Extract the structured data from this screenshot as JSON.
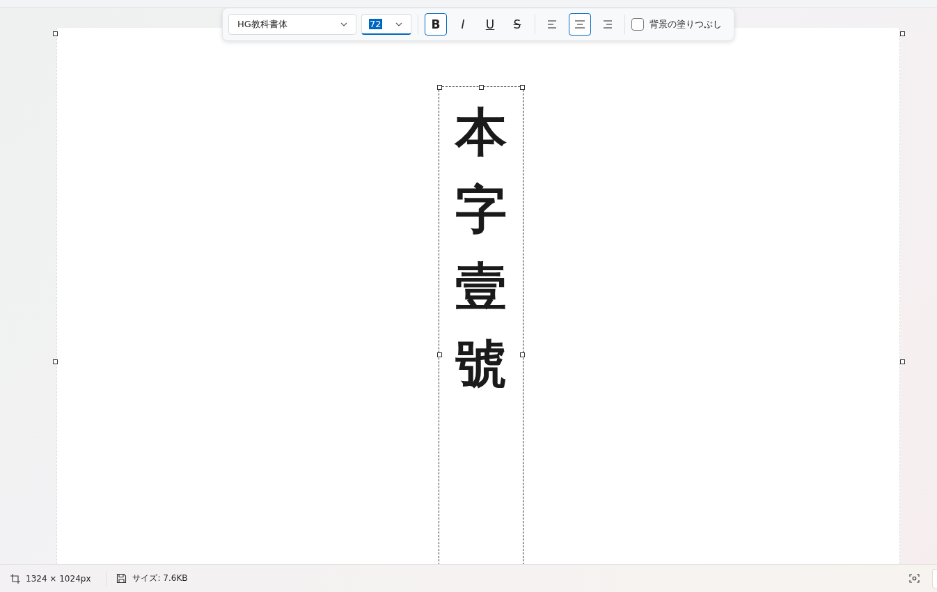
{
  "toolbar": {
    "font": {
      "value": "HG教科書体"
    },
    "size": {
      "value": "72",
      "selected": true
    },
    "format": [
      {
        "kind": "bold",
        "label": "B",
        "on": true
      },
      {
        "kind": "italic",
        "label": "I",
        "on": false
      },
      {
        "kind": "underline",
        "label": "U",
        "on": false
      },
      {
        "kind": "strikethrough",
        "label": "S",
        "on": false
      }
    ],
    "align": [
      {
        "kind": "left",
        "selected": false
      },
      {
        "kind": "center",
        "selected": true
      },
      {
        "kind": "right",
        "selected": false
      }
    ],
    "fill_background": {
      "label": "背景の塗りつぶし",
      "checked": false
    }
  },
  "text_box": {
    "text": "本字壹號",
    "selected": true
  },
  "status_bar": {
    "dimensions": "1324 × 1024px",
    "size": "サイズ: 7.6KB"
  }
}
